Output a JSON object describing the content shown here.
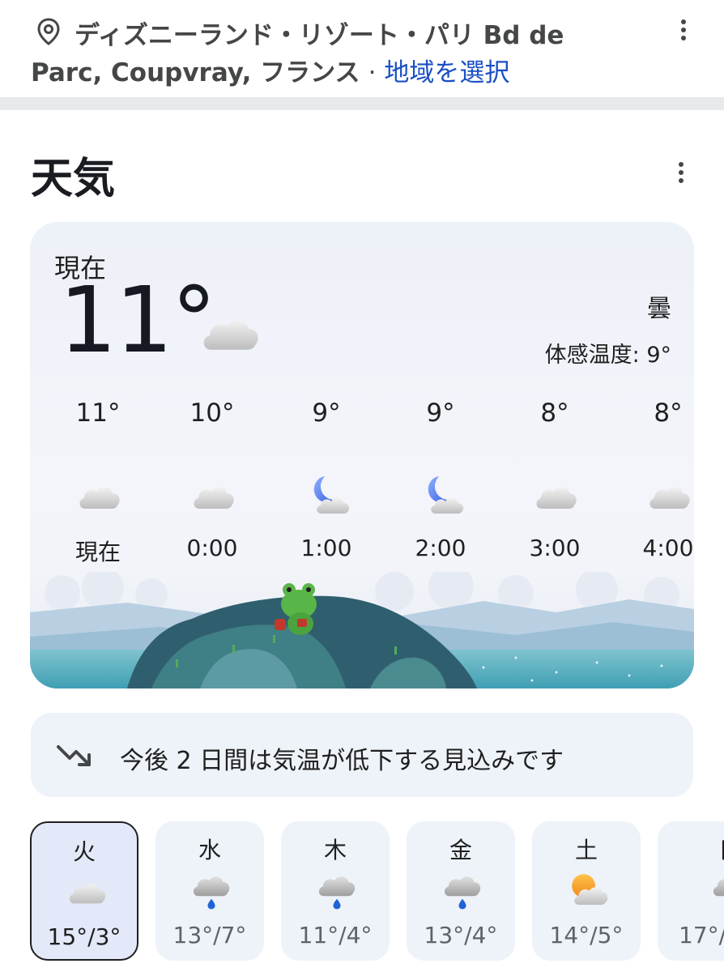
{
  "location": {
    "line1": "ディズニーランド・リゾート・パリ Bd de",
    "line2": "Parc, Coupvray, フランス",
    "separator": "·",
    "change_link": "地域を選択"
  },
  "title": "天気",
  "current": {
    "label": "現在",
    "temp": "11°",
    "condition": "曇",
    "feels_like": "体感温度: 9°",
    "icon": "cloud-icon"
  },
  "hourly": [
    {
      "temp": "11°",
      "time": "現在",
      "icon": "cloud-icon"
    },
    {
      "temp": "10°",
      "time": "0:00",
      "icon": "cloud-icon"
    },
    {
      "temp": "9°",
      "time": "1:00",
      "icon": "moon-cloud-icon"
    },
    {
      "temp": "9°",
      "time": "2:00",
      "icon": "moon-cloud-icon"
    },
    {
      "temp": "8°",
      "time": "3:00",
      "icon": "cloud-icon"
    },
    {
      "temp": "8°",
      "time": "4:00",
      "icon": "cloud-icon"
    }
  ],
  "trend": {
    "text": "今後 2 日間は気温が低下する見込みです",
    "icon": "trending-down-icon"
  },
  "daily": [
    {
      "day": "火",
      "range": "15°/3°",
      "icon": "cloud-icon",
      "selected": true
    },
    {
      "day": "水",
      "range": "13°/7°",
      "icon": "rain-icon"
    },
    {
      "day": "木",
      "range": "11°/4°",
      "icon": "rain-icon"
    },
    {
      "day": "金",
      "range": "13°/4°",
      "icon": "rain-icon"
    },
    {
      "day": "土",
      "range": "14°/5°",
      "icon": "partly-cloudy-icon"
    },
    {
      "day": "日",
      "range": "17°/",
      "icon": "rain-icon"
    }
  ],
  "colors": {
    "link": "#1a4fc4",
    "card_bg": "#eef2f9",
    "text": "#1f1f1f"
  }
}
